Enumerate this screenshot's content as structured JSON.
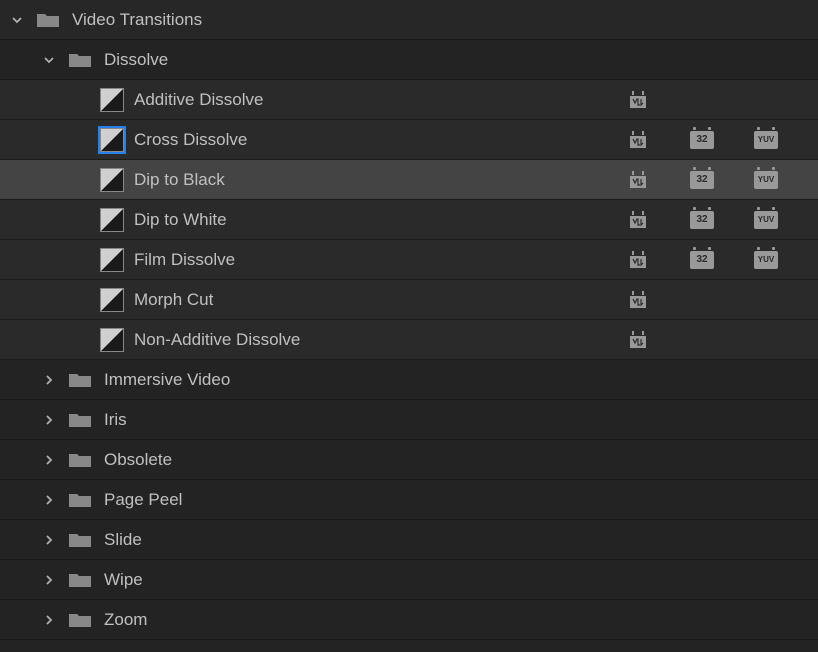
{
  "root": {
    "label": "Video Transitions",
    "expanded": true
  },
  "dissolve": {
    "label": "Dissolve",
    "expanded": true,
    "items": [
      {
        "label": "Additive Dissolve",
        "gpu": true,
        "b32": false,
        "yuv": false,
        "highlighted": false,
        "selected": false
      },
      {
        "label": "Cross Dissolve",
        "gpu": true,
        "b32": true,
        "yuv": true,
        "highlighted": true,
        "selected": false
      },
      {
        "label": "Dip to Black",
        "gpu": true,
        "b32": true,
        "yuv": true,
        "highlighted": false,
        "selected": true
      },
      {
        "label": "Dip to White",
        "gpu": true,
        "b32": true,
        "yuv": true,
        "highlighted": false,
        "selected": false
      },
      {
        "label": "Film Dissolve",
        "gpu": true,
        "b32": true,
        "yuv": true,
        "highlighted": false,
        "selected": false
      },
      {
        "label": "Morph Cut",
        "gpu": true,
        "b32": false,
        "yuv": false,
        "highlighted": false,
        "selected": false
      },
      {
        "label": "Non-Additive Dissolve",
        "gpu": true,
        "b32": false,
        "yuv": false,
        "highlighted": false,
        "selected": false
      }
    ]
  },
  "folders": [
    {
      "label": "Immersive Video"
    },
    {
      "label": "Iris"
    },
    {
      "label": "Obsolete"
    },
    {
      "label": "Page Peel"
    },
    {
      "label": "Slide"
    },
    {
      "label": "Wipe"
    },
    {
      "label": "Zoom"
    }
  ],
  "badge_labels": {
    "b32": "32",
    "yuv": "YUV"
  }
}
